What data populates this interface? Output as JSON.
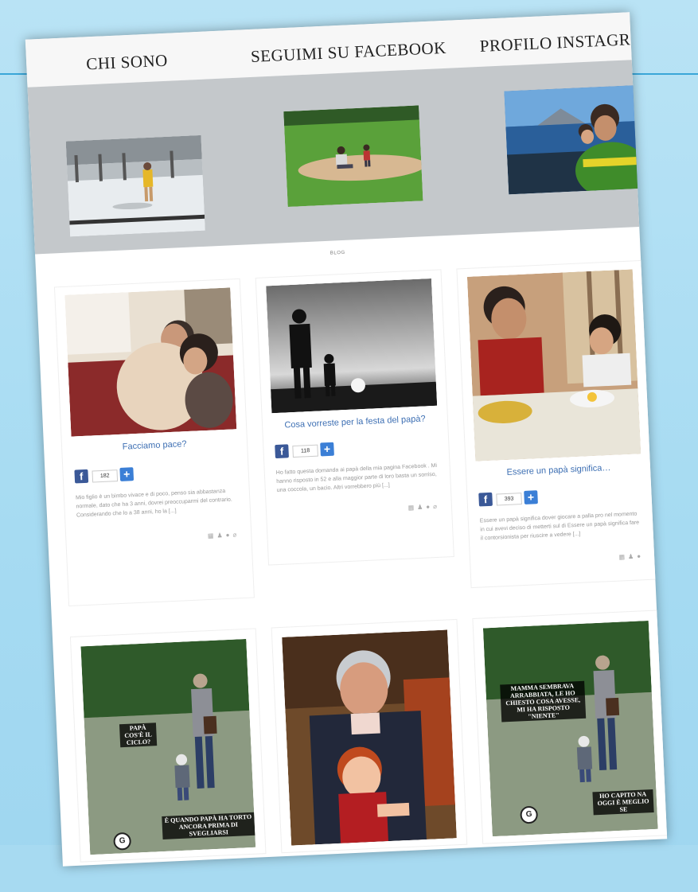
{
  "nav": {
    "items": [
      "CHI SONO",
      "SEGUIMI SU FACEBOOK",
      "PROFILO INSTAGR"
    ]
  },
  "blog": {
    "label": "BLOG"
  },
  "posts": [
    {
      "title": "Facciamo pace?",
      "share_count": "182",
      "excerpt": "Mio figlio è un bimbo vivace e di poco, penso sia abbastanza normale, dato che ha 3 anni, dovrei preoccuparmi del contrario. Considerando che lo a 38 anni, ho la [...]"
    },
    {
      "title": "Cosa vorreste per la festa del papà?",
      "share_count": "118",
      "excerpt": "Ho fatto questa domanda ai papà della mia pagina Facebook . Mi hanno risposto in 52 e alla maggior parte di loro basta un sorriso, una coccola, un bacio. Altri vorrebbero più [...]"
    },
    {
      "title": "Essere un papà significa…",
      "share_count": "393",
      "excerpt": "Essere un papà significa dover giocare a palla pro nel momento in cui avevi deciso di metterti sul di Essere un papà significa fare il contorsionista per riuscire a vedere [...]"
    }
  ],
  "memes": {
    "left_top": "PAPÀ COS'È IL CICLO?",
    "left_bottom": "È QUANDO PAPÀ HA TORTO ANCORA PRIMA DI SVEGLIARSI",
    "right_top": "MAMMA SEMBRAVA ARRABBIATA, LE HO CHIESTO COSA AVESSE, MI HA RISPOSTO \"NIENTE\"",
    "right_bottom": "HO CAPITO NA OGGI È MEGLIO SE"
  },
  "icons": {
    "facebook": "facebook-icon",
    "plus": "plus-icon",
    "meta": [
      "calendar-icon",
      "user-icon",
      "comment-icon",
      "link-icon"
    ]
  },
  "colors": {
    "facebook": "#3b5998",
    "title_link": "#3d6fb3",
    "hero_bg": "#c4c8cb",
    "backdrop": "#a6dbf2"
  }
}
